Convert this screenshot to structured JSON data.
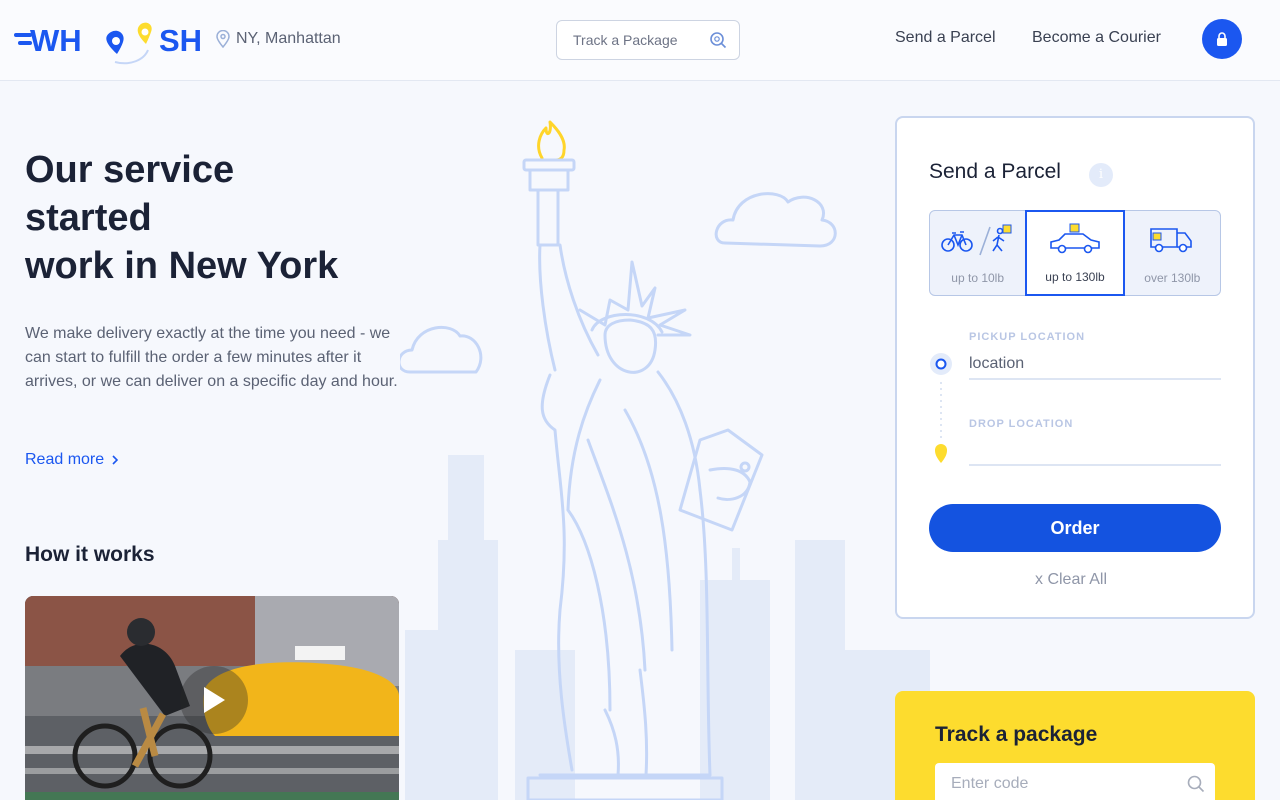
{
  "header": {
    "logo_text": "WHOOSH",
    "location": "NY, Manhattan",
    "track_placeholder": "Track a Package",
    "nav": {
      "send": "Send a Parcel",
      "courier": "Become a Courier"
    }
  },
  "hero": {
    "title_lines": [
      "Our service",
      "started",
      "work in New York"
    ],
    "description": "We make delivery exactly at the time you need - we can start to fulfill the order a few minutes after it arrives, or we can deliver on a specific day and hour.",
    "read_more": "Read more"
  },
  "how": {
    "title": "How it works"
  },
  "parcel": {
    "title": "Send a Parcel",
    "info": "i",
    "modes": [
      {
        "label": "up to 10lb",
        "icon": "bike-walker-icon"
      },
      {
        "label": "up to 130lb",
        "icon": "car-icon",
        "active": true
      },
      {
        "label": "over 130lb",
        "icon": "truck-icon"
      }
    ],
    "pickup_label": "PICKUP LOCATION",
    "pickup_value": "location",
    "drop_label": "DROP LOCATION",
    "drop_value": "",
    "order": "Order",
    "clear": "x  Clear All"
  },
  "track": {
    "title": "Track a package",
    "placeholder": "Enter code"
  },
  "colors": {
    "brand_blue": "#1b57f0",
    "brand_yellow": "#fddc2e",
    "illustration": "#c5d6f7"
  }
}
